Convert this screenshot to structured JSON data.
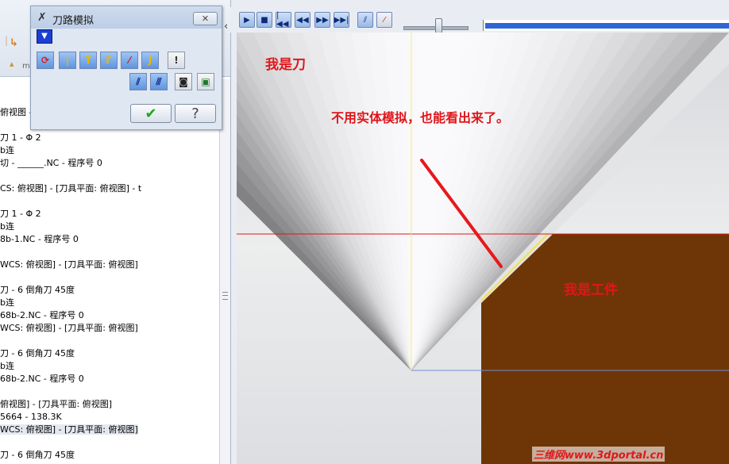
{
  "dialog": {
    "title": "刀路模拟",
    "close_label": "✕",
    "expand_label": "▼",
    "ok_symbol": "✔",
    "help_symbol": "?"
  },
  "tree_lines": [
    "俯视图 -",
    "刀 1 -                    Φ 2",
    "b连",
    "切 - ______.NC - 程序号 0",
    "CS: 俯视图] - [刀具平面: 俯视图] - t",
    "刀 1 -                    Φ 2",
    "b连",
    "8b-1.NC - 程序号 0",
    "WCS: 俯视图] - [刀具平面: 俯视图]",
    "刀 - 6 倒角刀 45度",
    "b连",
    "68b-2.NC - 程序号 0",
    "WCS: 俯视图] - [刀具平面: 俯视图]",
    "刀 - 6 倒角刀 45度",
    "b连",
    "68b-2.NC - 程序号 0",
    "俯视图] - [刀具平面: 俯视图]",
    "5664 - 138.3K",
    "WCS: 俯视图] - [刀具平面: 俯视图]",
    "刀 - 6 倒角刀 45度"
  ],
  "viewport": {
    "label_tool": "我是刀",
    "label_note": "不用实体模拟，也能看出来了。",
    "label_workpiece": "我是工件",
    "watermark": "三维网www.3dportal.cn"
  },
  "colors": {
    "annotation_red": "#e0161b",
    "workpiece_brown": "#6e3606",
    "progress_blue": "#2d67d6"
  },
  "playback": {
    "buttons": [
      "play-icon",
      "stop-icon",
      "skip-to-start-icon",
      "step-back-icon",
      "step-forward-icon",
      "skip-to-end-icon",
      "toolpath-display-icon",
      "tool-display-icon"
    ],
    "left_arrow": "‹"
  }
}
